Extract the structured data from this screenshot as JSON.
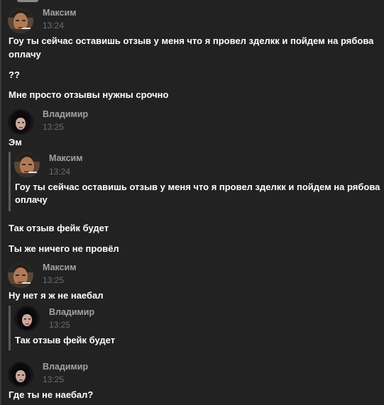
{
  "authors": {
    "maxim": "Максим",
    "vladimir": "Владимир"
  },
  "messages": [
    {
      "author": "Максим",
      "time": "13:24",
      "lines": [
        "Гоу ты сейчас оставишь отзыв у меня что я провел зделкк и пойдем на рябова",
        "оплачу"
      ]
    },
    {
      "text": "??"
    },
    {
      "text": "Мне просто отзывы нужны срочно"
    },
    {
      "author": "Владимир",
      "time": "13:25",
      "text": "Эм",
      "quote": {
        "author": "Максим",
        "time": "13:24",
        "lines": [
          "Гоу ты сейчас оставишь отзыв у меня что я провел зделкк и пойдем на рябова",
          "оплачу"
        ]
      }
    },
    {
      "text": "Так отзыв фейк будет"
    },
    {
      "text": "Ты же ничего не провёл"
    },
    {
      "author": "Максим",
      "time": "13:25",
      "text": "Ну нет я ж не наебал",
      "quote": {
        "author": "Владимир",
        "time": "13:25",
        "text": "Так отзыв фейк будет"
      }
    },
    {
      "author": "Владимир",
      "time": "13:25",
      "text": "Где ты не наебал?"
    }
  ],
  "icons": {
    "maxim_avatar": "maxim-avatar",
    "vladimir_avatar": "vladimir-avatar"
  },
  "colors": {
    "background": "#222222",
    "author_name": "#a3a3a3",
    "timestamp": "#6e6e6e",
    "message_text": "#ffffff",
    "quote_bar": "#5a5a5a"
  }
}
